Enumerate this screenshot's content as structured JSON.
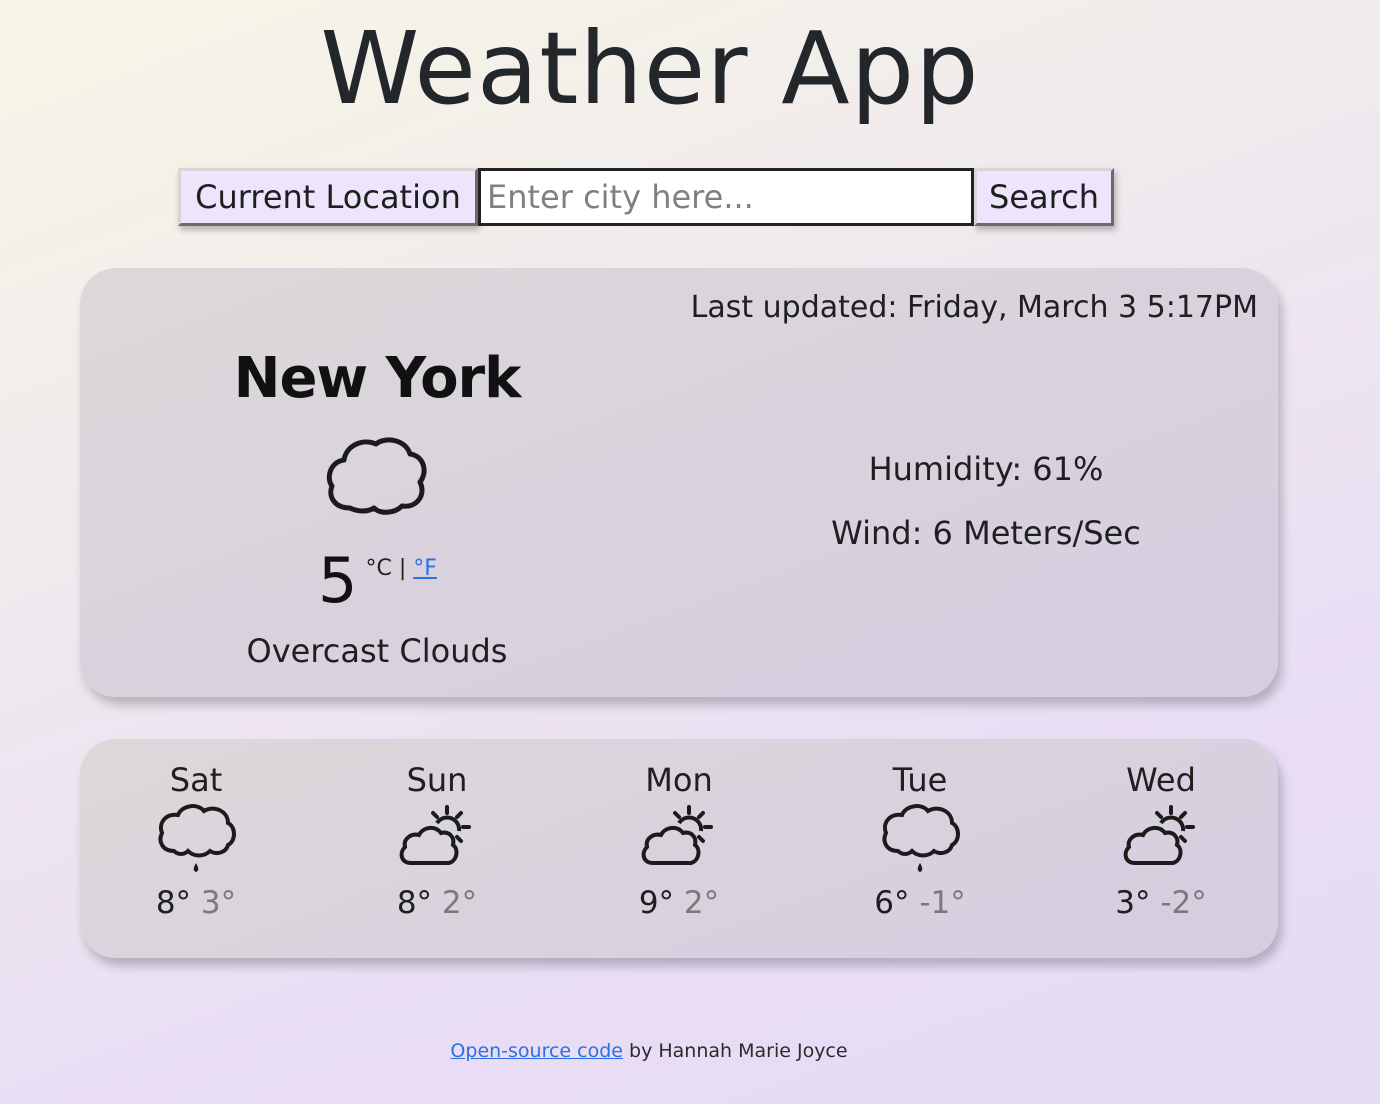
{
  "app": {
    "title": "Weather App"
  },
  "search": {
    "current_location_label": "Current Location",
    "placeholder": "Enter city here...",
    "value": "",
    "search_label": "Search"
  },
  "current": {
    "last_updated": "Last updated: Friday, March 3 5:17PM",
    "city": "New York",
    "icon": "overcast-cloud-icon",
    "temperature": "5",
    "unit_celsius": "°C",
    "unit_separator": "|",
    "unit_fahrenheit": "°F",
    "description": "Overcast Clouds",
    "humidity": "Humidity: 61%",
    "wind": "Wind: 6 Meters/Sec"
  },
  "forecast": [
    {
      "day": "Sat",
      "icon": "rain-cloud-icon",
      "max": "8°",
      "min": "3°"
    },
    {
      "day": "Sun",
      "icon": "sun-cloud-icon",
      "max": "8°",
      "min": "2°"
    },
    {
      "day": "Mon",
      "icon": "sun-cloud-icon",
      "max": "9°",
      "min": "2°"
    },
    {
      "day": "Tue",
      "icon": "rain-cloud-icon",
      "max": "6°",
      "min": "-1°"
    },
    {
      "day": "Wed",
      "icon": "sun-cloud-icon",
      "max": "3°",
      "min": "-2°"
    }
  ],
  "footer": {
    "link_text": "Open-source code",
    "suffix": " by Hannah Marie Joyce"
  },
  "colors": {
    "link": "#2a6fe6",
    "button_bg": "#ece5fb",
    "min_temp": "#7a7a7a"
  }
}
